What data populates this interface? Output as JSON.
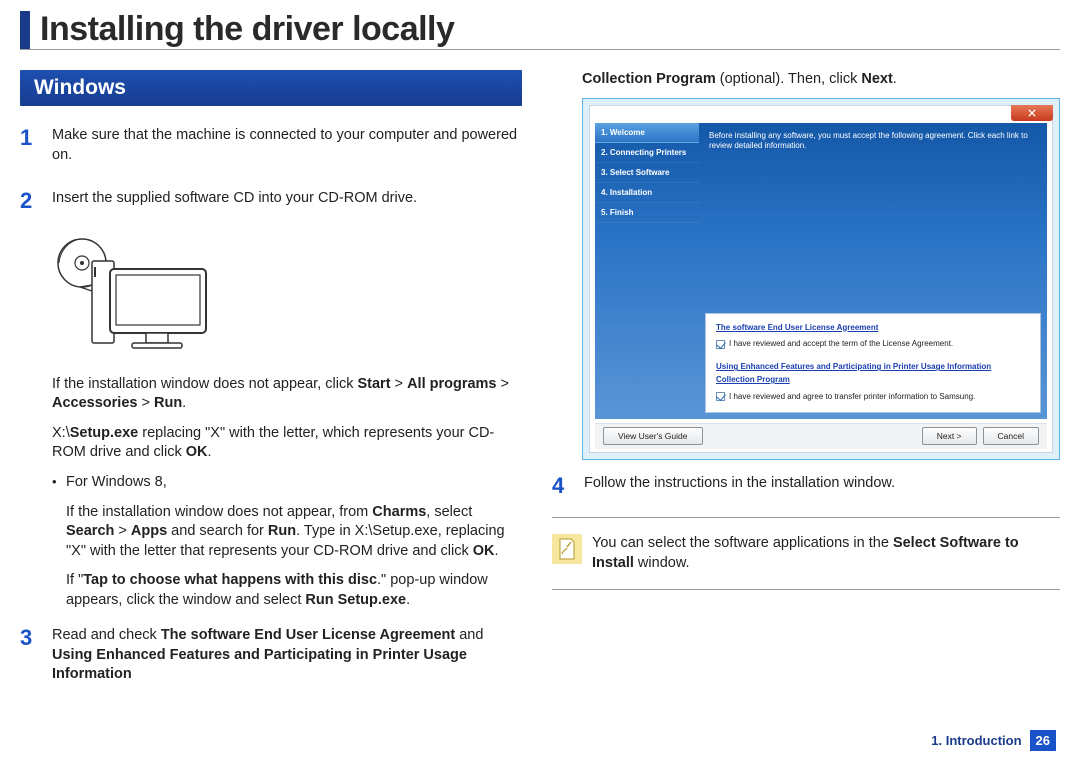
{
  "title": "Installing the driver locally",
  "section_header": "Windows",
  "steps": {
    "s1": {
      "num": "1",
      "text": "Make sure that the machine is connected to your computer and powered on."
    },
    "s2": {
      "num": "2",
      "text": "Insert the supplied software CD into your CD-ROM drive.",
      "p1_pre": "If the installation window does not appear, click ",
      "p1_b1": "Start",
      "p1_gt1": " > ",
      "p1_b2": "All programs",
      "p1_gt2": " > ",
      "p1_b3": "Accessories",
      "p1_gt3": " > ",
      "p1_b4": "Run",
      "p1_post": ".",
      "p2_pre": " X:\\",
      "p2_b1": "Setup.exe",
      "p2_post": " replacing \"X\" with the letter, which represents your CD-ROM drive and click ",
      "p2_b2": "OK",
      "p2_post2": ".",
      "bullet_label": "For Windows 8,",
      "b_p1_pre": "If the installation window does not appear, from ",
      "b_p1_b1": "Charms",
      "b_p1_mid1": ", select ",
      "b_p1_b2": "Search",
      "b_p1_gt": " > ",
      "b_p1_b3": "Apps",
      "b_p1_mid2": " and search for ",
      "b_p1_b4": "Run",
      "b_p1_mid3": ". Type in X:\\Setup.exe, replacing \"X\" with the letter that represents your CD-ROM drive and click ",
      "b_p1_b5": "OK",
      "b_p1_post": ".",
      "b_p2_pre": "If \"",
      "b_p2_b1": "Tap to choose what happens with this disc",
      "b_p2_mid": ".\" pop-up window appears, click the window and select ",
      "b_p2_b2": "Run Setup.exe",
      "b_p2_post": "."
    },
    "s3": {
      "num": "3",
      "pre": "Read and check ",
      "b1": "The software End User License Agreement",
      "mid": " and ",
      "b2": "Using Enhanced Features and Participating in Printer Usage Information ",
      "cont_b": "Collection Program",
      "cont_mid": " (optional). Then, click ",
      "cont_b2": "Next",
      "cont_post": "."
    },
    "s4": {
      "num": "4",
      "text": "Follow the instructions in the installation window."
    }
  },
  "installer": {
    "side": [
      "1. Welcome",
      "2. Connecting Printers",
      "3. Select Software",
      "4. Installation",
      "5. Finish"
    ],
    "top_text": "Before installing any software, you must accept the following agreement. Click each link to review detailed information.",
    "link1": "The software End User License Agreement",
    "check1": "I have reviewed and accept the term of the License Agreement.",
    "link2": "Using Enhanced Features and Participating in Printer Usage Information Collection Program",
    "check2": "I have reviewed and agree to transfer printer information to Samsung.",
    "btn_guide": "View User's Guide",
    "btn_next": "Next >",
    "btn_cancel": "Cancel"
  },
  "note": {
    "pre": "You can select the software applications in the ",
    "b": "Select Software to Install",
    "post": " window."
  },
  "footer": {
    "label": "1. Introduction",
    "page": "26"
  }
}
